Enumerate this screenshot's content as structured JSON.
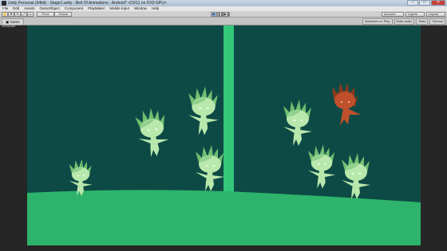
{
  "window": {
    "title": "Unity Personal (64bit) - Stage1.unity - Bell Of Animations - Android* <DX11 on DX9 GPU>",
    "minimize": "–",
    "maximize": "□",
    "close": "✕"
  },
  "menu": [
    "File",
    "Edit",
    "Assets",
    "GameObject",
    "Component",
    "PlayMaker",
    "Mobile Input",
    "Window",
    "Help"
  ],
  "toolbar": {
    "pivot": "Pivot",
    "global": "Global",
    "account": "Account",
    "layers": "Layers",
    "layout": "Layout"
  },
  "game_view": {
    "tab_label": "Game",
    "aspect": "1920x1080",
    "maximize_on_play": "Maximize on Play",
    "mute_audio": "Mute audio",
    "stats": "Stats",
    "gizmos": "Gizmos"
  },
  "colors": {
    "background": "#0e4a45",
    "ground": "#2db36b",
    "pillar": "#33c87a",
    "creature": "#b9e8ad",
    "creature_dark": "#6fbf71",
    "enemy": "#c0502c"
  }
}
